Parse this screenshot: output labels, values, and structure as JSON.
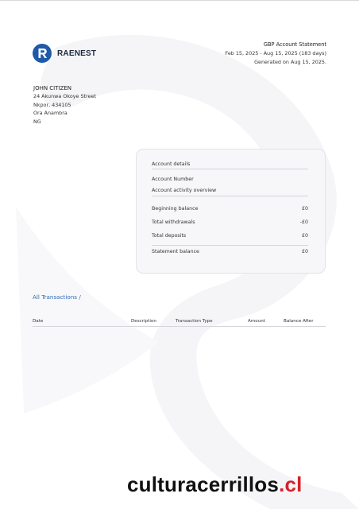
{
  "brand": {
    "name": "RAENEST",
    "accent": "#1e5aa8"
  },
  "statement": {
    "title": "GBP Account Statement",
    "period": "Feb 15, 2025 - Aug 15, 2025 (183 days)",
    "generated": "Generated on Aug 15, 2025."
  },
  "customer": {
    "name": "JOHN CITIZEN",
    "address_lines": [
      "24 Akunwa Okoye Street",
      "Nkpor, 434105",
      "Ora Anambra",
      "NG"
    ]
  },
  "account": {
    "heading": "Account details",
    "number_label": "Account Number",
    "overview_label": "Account activity overview",
    "rows": [
      {
        "label": "Beginning balance",
        "value": "£0"
      },
      {
        "label": "Total withdrawals",
        "value": "-£0"
      },
      {
        "label": "Total deposits",
        "value": "£0"
      }
    ],
    "statement_balance": {
      "label": "Statement balance",
      "value": "£0"
    }
  },
  "transactions": {
    "heading": "All Transactions /",
    "columns": [
      "Date",
      "Description",
      "Transaction Type",
      "Amount",
      "Balance After"
    ],
    "rows": []
  },
  "footer": {
    "site_main": "culturacerrillos",
    "site_dot": ".",
    "site_tld": "cl",
    "tld_color": "#d3232a"
  }
}
